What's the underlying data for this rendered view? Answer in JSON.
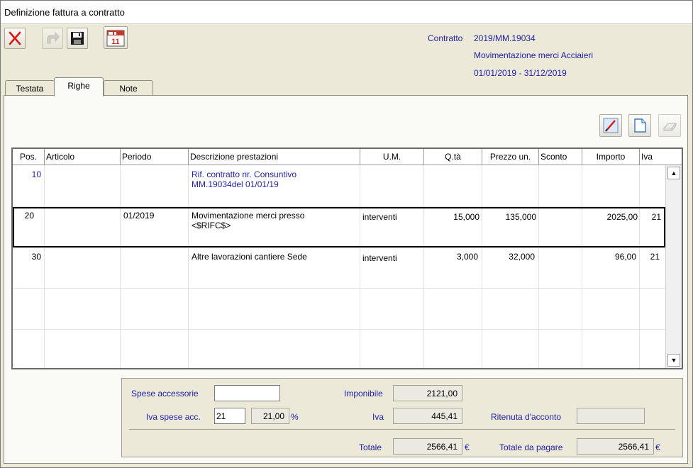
{
  "window": {
    "title": "Definizione fattura a contratto"
  },
  "toolbar": {
    "close_icon": "red-x-icon",
    "redo_icon": "redo-arrow-icon",
    "save_icon": "floppy-disk-icon",
    "calendar_icon": "calendar-icon",
    "calendar_text": "11"
  },
  "contract": {
    "label": "Contratto",
    "number": "2019/MM.19034",
    "description": "Movimentazione merci Acciaieri",
    "period": "01/01/2019 - 31/12/2019"
  },
  "tabs": [
    {
      "label": "Testata"
    },
    {
      "label": "Righe"
    },
    {
      "label": "Note"
    }
  ],
  "row_tools": {
    "edit_icon": "pencil-edit-icon",
    "new_icon": "new-document-icon",
    "erase_icon": "eraser-icon"
  },
  "grid": {
    "columns": [
      "Pos.",
      "Articolo",
      "Periodo",
      "Descrizione prestazioni",
      "U.M.",
      "Q.tà",
      "Prezzo un.",
      "Sconto",
      "Importo",
      "Iva"
    ],
    "rows": [
      {
        "pos": "10",
        "articolo": "",
        "periodo": "",
        "desc_line1": "Rif. contratto nr. Consuntivo",
        "desc_line2": "MM.19034del 01/01/19",
        "um": "",
        "qta": "",
        "prezzo": "",
        "sconto": "",
        "importo": "",
        "iva": ""
      },
      {
        "pos": "20",
        "articolo": "",
        "periodo": "01/2019",
        "desc_line1": "Movimentazione merci presso",
        "desc_line2": "<$RIFC$>",
        "um": "interventi",
        "qta": "15,000",
        "prezzo": "135,000",
        "sconto": "",
        "importo": "2025,00",
        "iva": "21"
      },
      {
        "pos": "30",
        "articolo": "",
        "periodo": "",
        "desc_line1": "Altre lavorazioni cantiere Sede",
        "desc_line2": "",
        "um": "interventi",
        "qta": "3,000",
        "prezzo": "32,000",
        "sconto": "",
        "importo": "96,00",
        "iva": "21"
      }
    ],
    "scroll_up": "▲",
    "scroll_down": "▼"
  },
  "totals": {
    "spese_acc_label": "Spese accessorie",
    "spese_acc_value": "",
    "iva_spese_label": "Iva spese acc.",
    "iva_spese_code": "21",
    "iva_spese_rate": "21,00",
    "percent": "%",
    "imponibile_label": "Imponibile",
    "imponibile_value": "2121,00",
    "iva_label": "Iva",
    "iva_value": "445,41",
    "ritenuta_label": "Ritenuta d'acconto",
    "ritenuta_value": "",
    "totale_label": "Totale",
    "totale_value": "2566,41",
    "currency": "€",
    "totale_pagare_label": "Totale da pagare",
    "totale_pagare_value": "2566,41"
  }
}
